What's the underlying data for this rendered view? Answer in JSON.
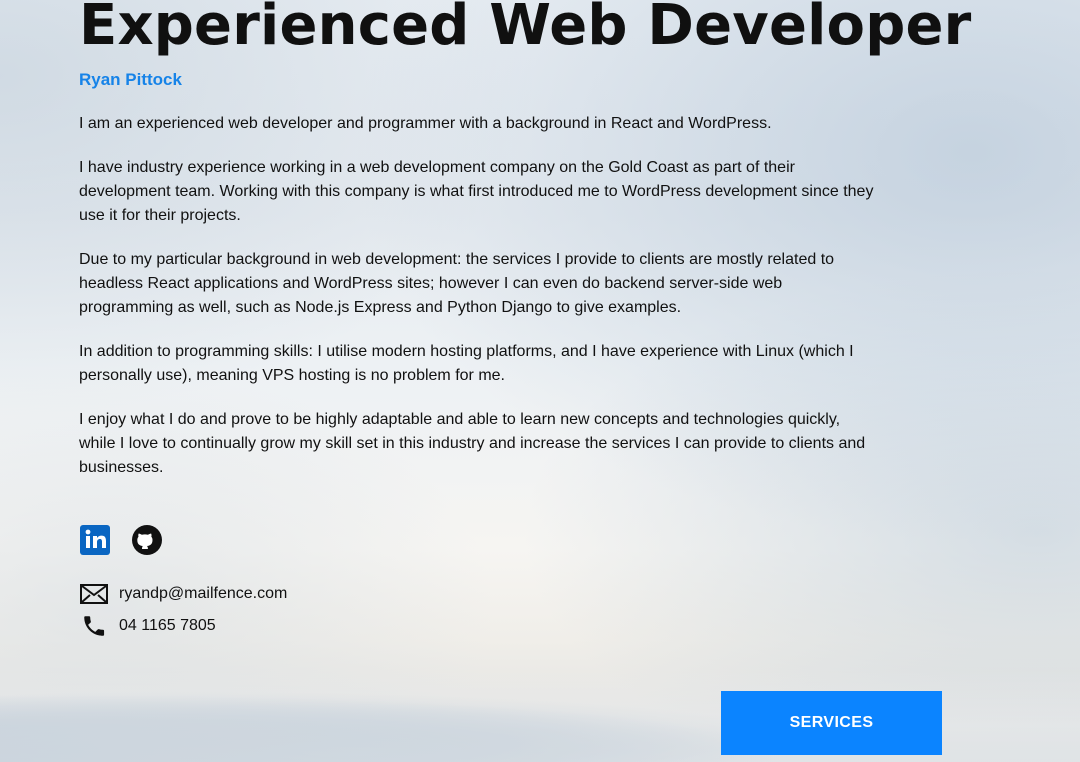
{
  "hero": {
    "title": "Experienced Web Developer",
    "author": "Ryan Pittock"
  },
  "bio": {
    "paragraphs": [
      "I am an experienced web developer and programmer with a background in React and WordPress.",
      "I have industry experience working in a web development company on the Gold Coast as part of their development team. Working with this company is what first introduced me to WordPress development since they use it for their projects.",
      "Due to my particular background in web development: the services I provide to clients are mostly related to headless React applications and WordPress sites; however I can even do backend server-side web programming as well, such as Node.js Express and Python Django to give examples.",
      "In addition to programming skills: I utilise modern hosting platforms, and I have experience with Linux (which I personally use), meaning VPS hosting is no problem for me.",
      "I enjoy what I do and prove to be highly adaptable and able to learn new concepts and technologies quickly, while I love to continually grow my skill set in this industry and increase the services I can provide to clients and businesses."
    ]
  },
  "social": {
    "items": [
      {
        "name": "linkedin-icon",
        "color": "#0a66c2"
      },
      {
        "name": "github-icon",
        "color": "#111111"
      }
    ]
  },
  "contact": {
    "email": "ryandp@mailfence.com",
    "phone": "04 1165 7805",
    "icons": {
      "email": "mail-icon",
      "phone": "phone-icon"
    }
  },
  "actions": {
    "services_label": "SERVICES",
    "accent_color": "#0b84ff"
  }
}
